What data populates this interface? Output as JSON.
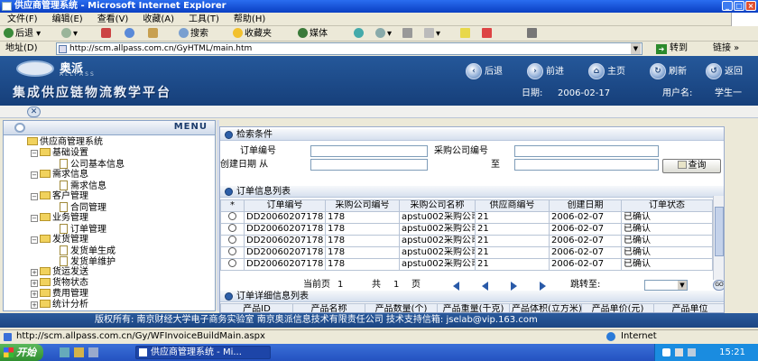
{
  "window": {
    "title": "供应商管理系统 - Microsoft Internet Explorer",
    "min": "_",
    "max": "□",
    "close": "×"
  },
  "menu": [
    "文件(F)",
    "编辑(E)",
    "查看(V)",
    "收藏(A)",
    "工具(T)",
    "帮助(H)"
  ],
  "toolbar": {
    "back": "后退",
    "search": "搜索",
    "favorites": "收藏夹",
    "media": "媒体"
  },
  "address": {
    "label": "地址(D)",
    "url": "http://scm.allpass.com.cn/GyHTML/main.htm",
    "go": "转到",
    "links": "链接 »"
  },
  "banner": {
    "logo_text": "奥派",
    "logo_sub": "ALLPASS",
    "platform": "集成供应链物流教学平台",
    "nav": [
      "后退",
      "前进",
      "主页",
      "刷新",
      "返回"
    ],
    "date_label": "日期:",
    "date": "2006-02-17",
    "user_label": "用户名:",
    "user": "学生一"
  },
  "sidebar": {
    "title": "MENU",
    "items": [
      {
        "label": "供应商管理系统",
        "level": 0,
        "kind": "root"
      },
      {
        "label": "基础设置",
        "level": 1,
        "kind": "folder",
        "toggle": "−"
      },
      {
        "label": "公司基本信息",
        "level": 2,
        "kind": "doc"
      },
      {
        "label": "需求信息",
        "level": 1,
        "kind": "folder",
        "toggle": "−"
      },
      {
        "label": "需求信息",
        "level": 2,
        "kind": "doc"
      },
      {
        "label": "客户管理",
        "level": 1,
        "kind": "folder",
        "toggle": "−"
      },
      {
        "label": "合同管理",
        "level": 2,
        "kind": "doc"
      },
      {
        "label": "业务管理",
        "level": 1,
        "kind": "folder",
        "toggle": "−"
      },
      {
        "label": "订单管理",
        "level": 2,
        "kind": "doc"
      },
      {
        "label": "发货管理",
        "level": 1,
        "kind": "folder",
        "toggle": "−"
      },
      {
        "label": "发货单生成",
        "level": 2,
        "kind": "doc"
      },
      {
        "label": "发货单维护",
        "level": 2,
        "kind": "doc"
      },
      {
        "label": "货运发送",
        "level": 1,
        "kind": "folder",
        "toggle": "+"
      },
      {
        "label": "货物状态",
        "level": 1,
        "kind": "folder",
        "toggle": "+"
      },
      {
        "label": "费用管理",
        "level": 1,
        "kind": "folder",
        "toggle": "+"
      },
      {
        "label": "统计分析",
        "level": 1,
        "kind": "folder",
        "toggle": "+"
      }
    ]
  },
  "search": {
    "title": "检索条件",
    "order_no": "订单编号",
    "buyer_no": "采购公司编号",
    "created_from": "创建日期 从",
    "to": "至",
    "query_button": "查询"
  },
  "orders": {
    "title": "订单信息列表",
    "columns": [
      "*",
      "订单编号",
      "采购公司编号",
      "采购公司名称",
      "供应商编号",
      "创建日期",
      "订单状态"
    ],
    "rows": [
      [
        "",
        "DD20060207178",
        "178",
        "apstu002采购公司",
        "21",
        "2006-02-07",
        "已确认"
      ],
      [
        "",
        "DD20060207178",
        "178",
        "apstu002采购公司",
        "21",
        "2006-02-07",
        "已确认"
      ],
      [
        "",
        "DD20060207178",
        "178",
        "apstu002采购公司",
        "21",
        "2006-02-07",
        "已确认"
      ],
      [
        "",
        "DD20060207178",
        "178",
        "apstu002采购公司",
        "21",
        "2006-02-07",
        "已确认"
      ],
      [
        "",
        "DD20060207178",
        "178",
        "apstu002采购公司",
        "21",
        "2006-02-07",
        "已确认"
      ]
    ]
  },
  "pager": {
    "current_label": "当前页",
    "current": "1",
    "total_label": "共",
    "total": "1",
    "page_unit": "页",
    "jump_label": "跳转至:",
    "go": "GO"
  },
  "details": {
    "title": "订单详细信息列表",
    "columns": [
      "产品ID",
      "产品名称",
      "产品数量(个)",
      "产品重量(千克)",
      "产品体积(立方米)",
      "产品单价(元)",
      "产品单位"
    ]
  },
  "footer": {
    "text": "版权所有: 南京财经大学电子商务实验室 南京奥派信息技术有限责任公司 技术支持信箱: jselab@vip.163.com"
  },
  "status": {
    "url": "http://scm.allpass.com.cn/Gy/WFInvoiceBuildMain.aspx",
    "zone": "Internet"
  },
  "taskbar": {
    "start": "开始",
    "task": "供应商管理系统 - Mi...",
    "clock": "15:21"
  }
}
